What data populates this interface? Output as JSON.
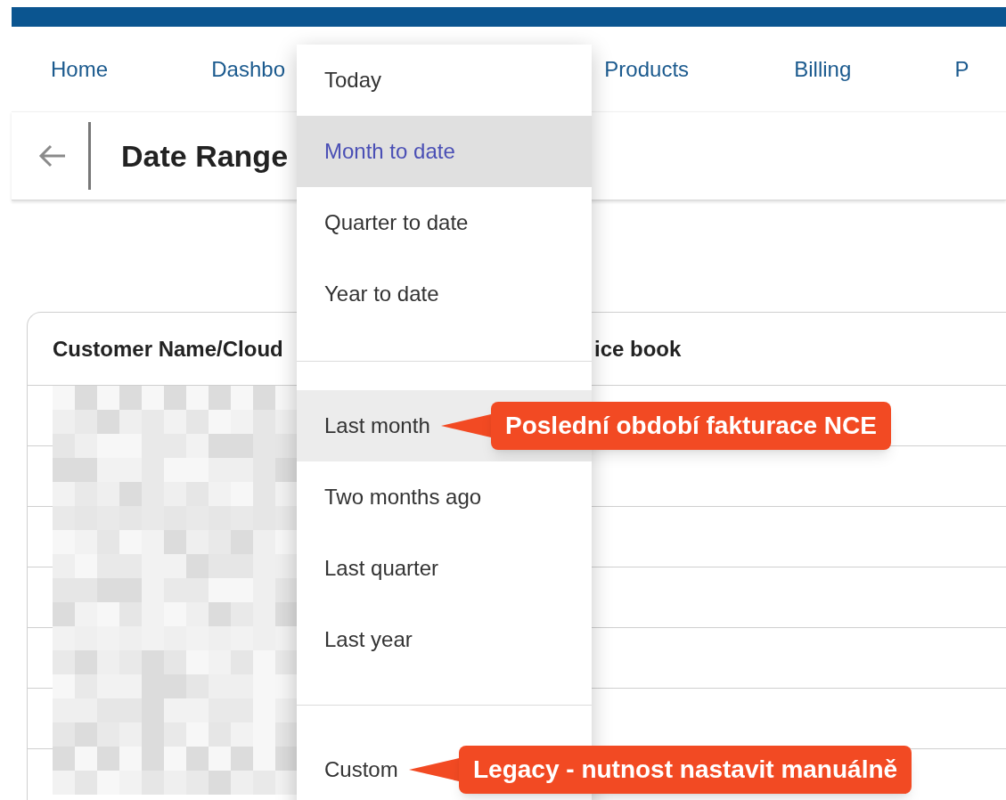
{
  "nav": {
    "items": [
      "Home",
      "Dashbo",
      "Products",
      "Billing",
      "P"
    ]
  },
  "header": {
    "title": "Date Range"
  },
  "table": {
    "columns": [
      "Customer Name/Cloud",
      "ice book"
    ],
    "body": {
      "kind": "picture"
    }
  },
  "menu": {
    "sections": [
      {
        "items": [
          {
            "label": "Today",
            "selected": false,
            "hovered": false
          },
          {
            "label": "Month to date",
            "selected": true,
            "hovered": false
          },
          {
            "label": "Quarter to date",
            "selected": false,
            "hovered": false
          },
          {
            "label": "Year to date",
            "selected": false,
            "hovered": false
          }
        ]
      },
      {
        "items": [
          {
            "label": "Last month",
            "selected": false,
            "hovered": true,
            "callout": "Poslední období fakturace NCE"
          },
          {
            "label": "Two months ago",
            "selected": false,
            "hovered": false
          },
          {
            "label": "Last quarter",
            "selected": false,
            "hovered": false
          },
          {
            "label": "Last year",
            "selected": false,
            "hovered": false
          }
        ]
      },
      {
        "items": [
          {
            "label": "Custom",
            "selected": false,
            "hovered": false,
            "callout": "Legacy - nutnost nastavit manuálně"
          }
        ]
      }
    ]
  }
}
